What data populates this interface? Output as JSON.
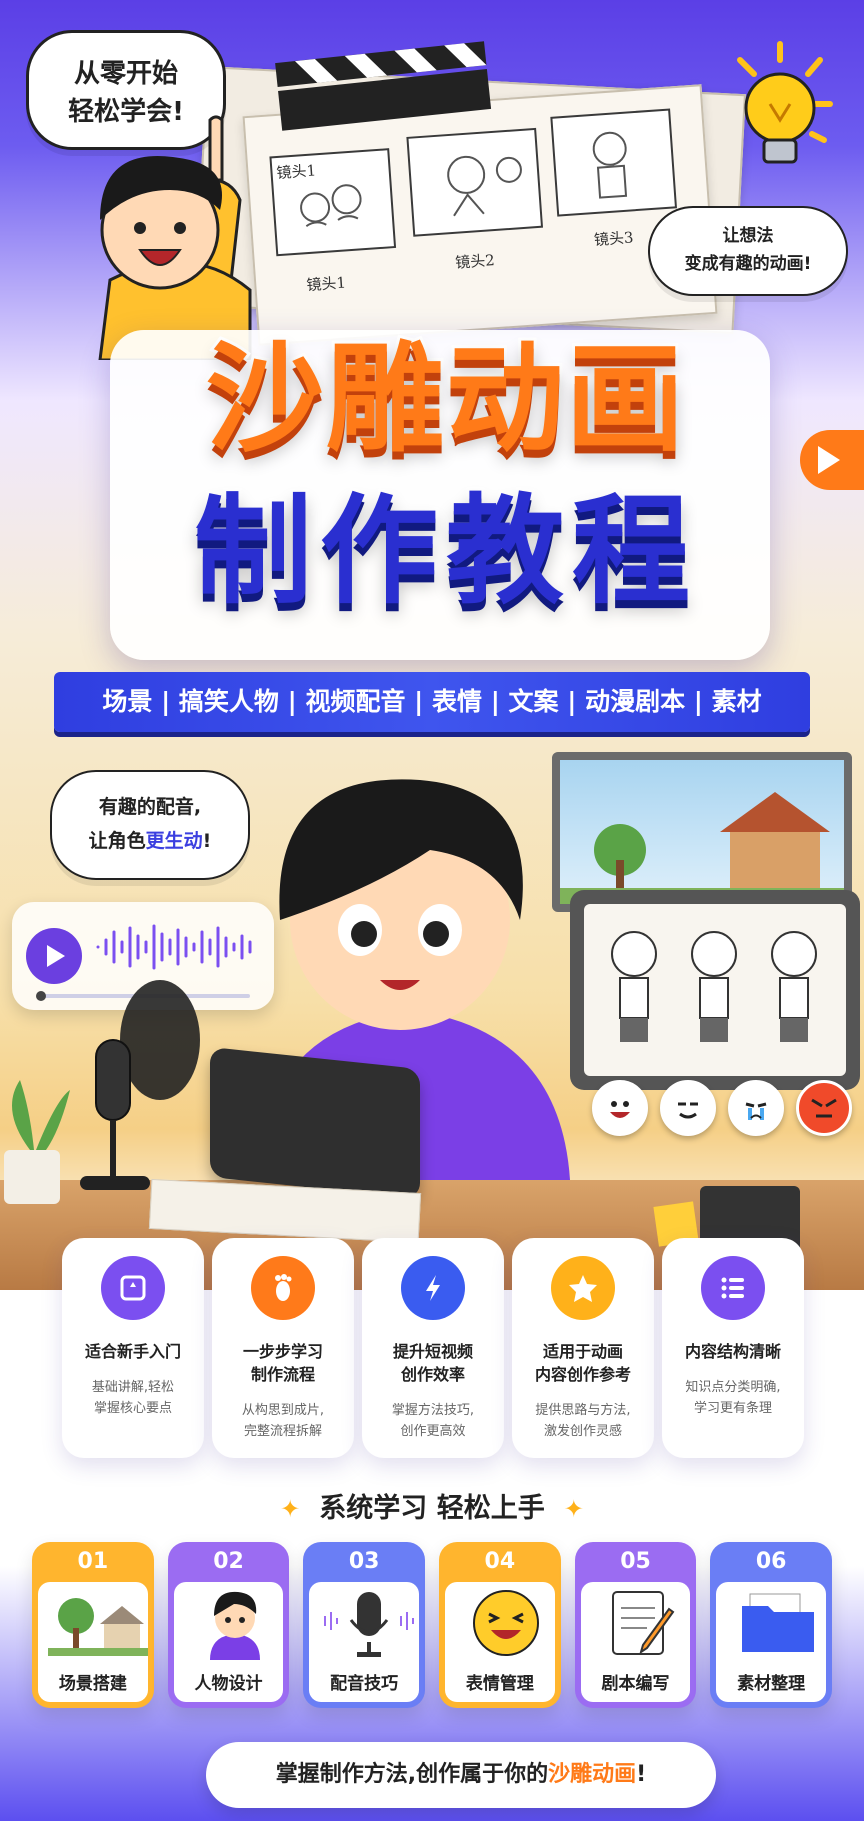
{
  "bubbles": {
    "top_left": [
      "从零开始",
      "轻松学会!"
    ],
    "top_right": [
      "让想法",
      "变成有趣的动画!"
    ],
    "voice": [
      "有趣的配音,",
      "让角色",
      "更生动",
      "!"
    ]
  },
  "storyboard": {
    "labels": [
      "镜头1",
      "镜头2",
      "镜头3"
    ],
    "first_label_top": "镜头1"
  },
  "title": {
    "line1": "沙雕动画",
    "line2": "制作教程"
  },
  "ribbon": "场景 | 搞笑人物 | 视频配音 | 表情 | 文案 | 动漫剧本 | 素材",
  "features": [
    {
      "title": [
        "适合新手入门"
      ],
      "desc": [
        "基础讲解,轻松",
        "掌握核心要点"
      ],
      "icon": "image-icon",
      "color": "#7b4ff0"
    },
    {
      "title": [
        "一步步学习",
        "制作流程"
      ],
      "desc": [
        "从构思到成片,",
        "完整流程拆解"
      ],
      "icon": "footprint-icon",
      "color": "#ff7a1a"
    },
    {
      "title": [
        "提升短视频",
        "创作效率"
      ],
      "desc": [
        "掌握方法技巧,",
        "创作更高效"
      ],
      "icon": "lightning-icon",
      "color": "#3a5cf0"
    },
    {
      "title": [
        "适用于动画",
        "内容创作参考"
      ],
      "desc": [
        "提供思路与方法,",
        "激发创作灵感"
      ],
      "icon": "star-icon",
      "color": "#ffb11a"
    },
    {
      "title": [
        "内容结构清晰"
      ],
      "desc": [
        "知识点分类明确,",
        "学习更有条理"
      ],
      "icon": "list-icon",
      "color": "#7b4ff0"
    }
  ],
  "section_title": "系统学习 轻松上手",
  "steps": [
    {
      "num": "01",
      "label": "场景搭建",
      "color": "#ffb52e",
      "icon": "tree-house-icon"
    },
    {
      "num": "02",
      "label": "人物设计",
      "color": "#9b6cf2",
      "icon": "character-icon"
    },
    {
      "num": "03",
      "label": "配音技巧",
      "color": "#6a7ef5",
      "icon": "microphone-icon"
    },
    {
      "num": "04",
      "label": "表情管理",
      "color": "#ffb52e",
      "icon": "laugh-face-icon"
    },
    {
      "num": "05",
      "label": "剧本编写",
      "color": "#9b6cf2",
      "icon": "notebook-icon"
    },
    {
      "num": "06",
      "label": "素材整理",
      "color": "#6a7ef5",
      "icon": "folder-icon"
    }
  ],
  "footer": {
    "prefix": "掌握制作方法,创作属于你的",
    "highlight": "沙雕动画",
    "suffix": "!"
  },
  "colors": {
    "orange": "#ff7a18",
    "blue": "#2a2fd0",
    "purple": "#7b4ff0",
    "yellow": "#ffc21a"
  }
}
